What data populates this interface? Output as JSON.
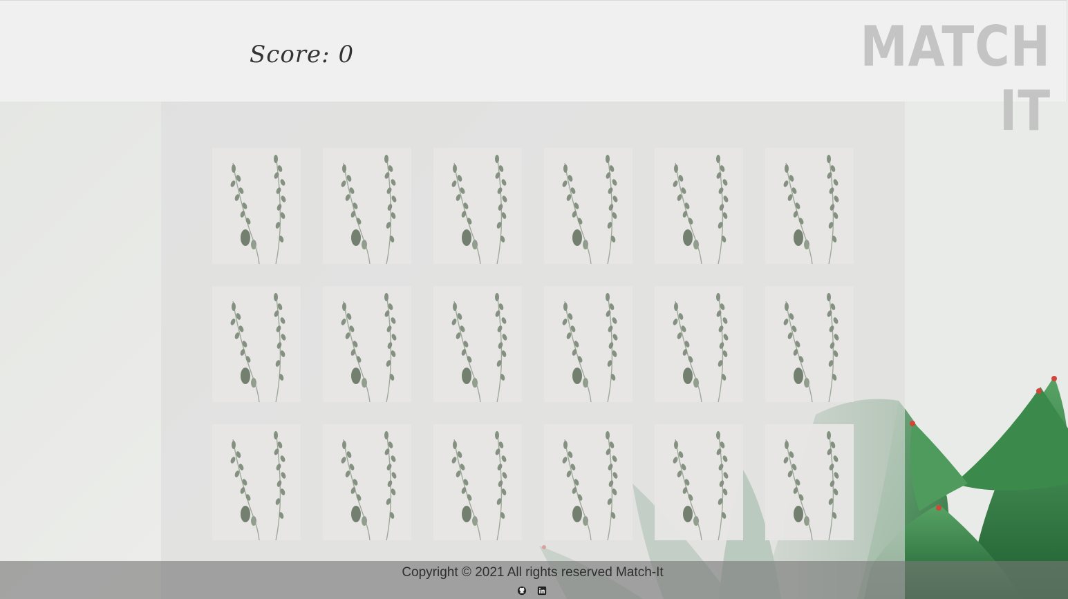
{
  "header": {
    "score_label": "Score:",
    "score_value": "0",
    "brand": "MATCH IT"
  },
  "board": {
    "rows": 3,
    "columns": 6,
    "cards_face": "plant-sprig-card-back"
  },
  "footer": {
    "copyright": "Copyright © 2021 All rights reserved Match-It",
    "social_icons": [
      "github-icon",
      "linkedin-icon"
    ]
  },
  "colors": {
    "header_bg": "#f0f0f0",
    "brand_text": "#c4c4c4",
    "board_overlay": "#dcdcdc",
    "footer_bg": "#7a7a7a",
    "succulent_green": "#3f8a4f"
  }
}
